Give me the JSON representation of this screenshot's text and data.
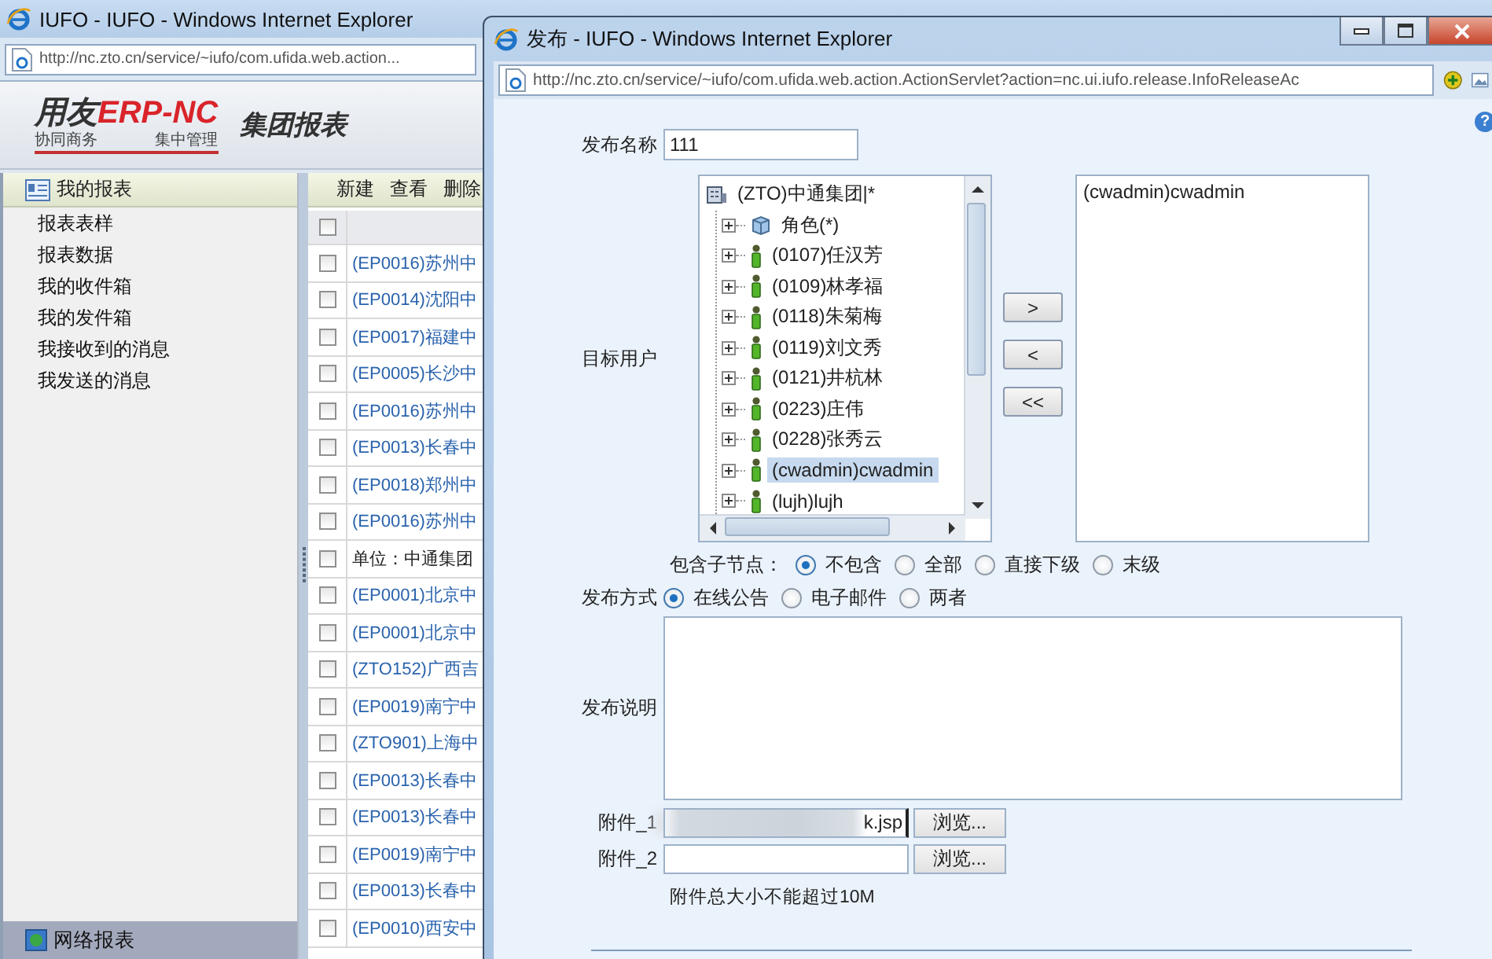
{
  "main_window": {
    "title": "IUFO - IUFO - Windows Internet Explorer",
    "address": "http://nc.zto.cn/service/~iufo/com.ufida.web.action..."
  },
  "header": {
    "logo_brand": "用友",
    "logo_product": "ERP-",
    "logo_suffix": "NC",
    "logo_tagline": [
      "协同商务",
      "集中管理"
    ],
    "title": "集团报表"
  },
  "sidebar": {
    "title": "我的报表",
    "items": [
      {
        "label": "报表表样"
      },
      {
        "label": "报表数据"
      },
      {
        "label": "我的收件箱"
      },
      {
        "label": "我的发件箱"
      },
      {
        "label": "我接收到的消息"
      },
      {
        "label": "我发送的消息"
      }
    ],
    "footer": "网络报表"
  },
  "toolbar": [
    "新建",
    "查看",
    "删除"
  ],
  "table": {
    "header_checked": false,
    "rows": [
      {
        "kind": "link",
        "text": "(EP0016)苏州中",
        "checked": false
      },
      {
        "kind": "link",
        "text": "(EP0014)沈阳中",
        "checked": false
      },
      {
        "kind": "link",
        "text": "(EP0017)福建中",
        "checked": false
      },
      {
        "kind": "link",
        "text": "(EP0005)长沙中",
        "checked": false
      },
      {
        "kind": "link",
        "text": "(EP0016)苏州中",
        "checked": false
      },
      {
        "kind": "link",
        "text": "(EP0013)长春中",
        "checked": false
      },
      {
        "kind": "link",
        "text": "(EP0018)郑州中",
        "checked": false
      },
      {
        "kind": "link",
        "text": "(EP0016)苏州中",
        "checked": false
      },
      {
        "kind": "text",
        "text": "单位：中通集团",
        "checked": false
      },
      {
        "kind": "link",
        "text": "(EP0001)北京中",
        "checked": false
      },
      {
        "kind": "link",
        "text": "(EP0001)北京中",
        "checked": false
      },
      {
        "kind": "link",
        "text": "(ZTO152)广西吉",
        "checked": false
      },
      {
        "kind": "link",
        "text": "(EP0019)南宁中",
        "checked": false
      },
      {
        "kind": "link",
        "text": "(ZTO901)上海中",
        "checked": false
      },
      {
        "kind": "link",
        "text": "(EP0013)长春中",
        "checked": false
      },
      {
        "kind": "link",
        "text": "(EP0013)长春中",
        "checked": false
      },
      {
        "kind": "link",
        "text": "(EP0019)南宁中",
        "checked": false
      },
      {
        "kind": "link",
        "text": "(EP0013)长春中",
        "checked": false
      },
      {
        "kind": "link",
        "text": "(EP0010)西安中",
        "checked": false
      }
    ]
  },
  "dialog": {
    "title": "发布 - IUFO - Windows Internet Explorer",
    "address": "http://nc.zto.cn/service/~iufo/com.ufida.web.action.ActionServlet?action=nc.ui.iufo.release.InfoReleaseAc",
    "help": "?",
    "name_label": "发布名称",
    "name_value": "111",
    "target_label": "目标用户",
    "tree": {
      "label": "(ZTO)中通集团|*",
      "children": [
        {
          "kind": "role",
          "label": "角色(*)",
          "expanded": false,
          "selected": false
        },
        {
          "kind": "user",
          "label": "(0107)任汉芳",
          "expanded": false,
          "selected": false
        },
        {
          "kind": "user",
          "label": "(0109)林孝福",
          "expanded": false,
          "selected": false
        },
        {
          "kind": "user",
          "label": "(0118)朱菊梅",
          "expanded": false,
          "selected": false
        },
        {
          "kind": "user",
          "label": "(0119)刘文秀",
          "expanded": false,
          "selected": false
        },
        {
          "kind": "user",
          "label": "(0121)井杭林",
          "expanded": false,
          "selected": false
        },
        {
          "kind": "user",
          "label": "(0223)庄伟",
          "expanded": false,
          "selected": false
        },
        {
          "kind": "user",
          "label": "(0228)张秀云",
          "expanded": false,
          "selected": false
        },
        {
          "kind": "user",
          "label": "(cwadmin)cwadmin",
          "expanded": false,
          "selected": true
        },
        {
          "kind": "user",
          "label": "(lujh)lujh",
          "expanded": false,
          "selected": false
        }
      ]
    },
    "move_buttons": [
      ">",
      "<",
      "<<"
    ],
    "selected_users": [
      "(cwadmin)cwadmin"
    ],
    "include_label": "包含子节点：",
    "include_options": [
      {
        "label": "不包含",
        "selected": true
      },
      {
        "label": "全部",
        "selected": false
      },
      {
        "label": "直接下级",
        "selected": false
      },
      {
        "label": "末级",
        "selected": false
      }
    ],
    "method_label": "发布方式",
    "method_options": [
      {
        "label": "在线公告",
        "selected": true
      },
      {
        "label": "电子邮件",
        "selected": false
      },
      {
        "label": "两者",
        "selected": false
      }
    ],
    "description_label": "发布说明",
    "attachments": [
      {
        "label": "附件_1",
        "value": "k.jsp",
        "button": "浏览...",
        "redacted": true
      },
      {
        "label": "附件_2",
        "button": "浏览...",
        "redacted": false
      }
    ],
    "note": "附件总大小不能超过10M"
  }
}
